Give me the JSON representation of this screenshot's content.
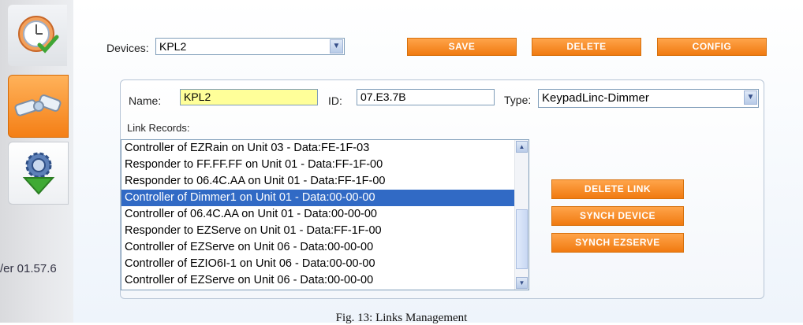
{
  "sidebar": {
    "version": "/er 01.57.6",
    "buttons": [
      {
        "icon": "clock-check-icon"
      },
      {
        "icon": "link-connector-icon"
      },
      {
        "icon": "gear-download-icon"
      }
    ]
  },
  "toolbar": {
    "devices_label": "Devices:",
    "devices_value": "KPL2",
    "save_label": "SAVE",
    "delete_label": "DELETE",
    "config_label": "CONFIG"
  },
  "device": {
    "name_label": "Name:",
    "name_value": "KPL2",
    "id_label": "ID:",
    "id_value": "07.E3.7B",
    "type_label": "Type:",
    "type_value": "KeypadLinc-Dimmer"
  },
  "links": {
    "label": "Link Records:",
    "items": [
      "Controller of EZRain on Unit 03 - Data:FE-1F-03",
      "Responder to FF.FF.FF on Unit 01 - Data:FF-1F-00",
      "Responder to 06.4C.AA on Unit 01 - Data:FF-1F-00",
      "Controller of Dimmer1 on Unit 01 - Data:00-00-00",
      "Controller of 06.4C.AA on Unit 01 - Data:00-00-00",
      "Responder to EZServe on Unit 01 - Data:FF-1F-00",
      "Controller of EZServe on Unit 06 - Data:00-00-00",
      "Controller of EZIO6I-1 on Unit 06 - Data:00-00-00",
      "Controller of EZServe on Unit 06 - Data:00-00-00"
    ],
    "selected_index": 3
  },
  "actions": {
    "delete_link": "DELETE LINK",
    "synch_device": "SYNCH DEVICE",
    "synch_ezserve": "SYNCH EZSERVE"
  },
  "caption": "Fig. 13: Links Management",
  "colors": {
    "accent_orange": "#f07a10",
    "selection_blue": "#316ac5",
    "name_field_yellow": "#ffff99"
  }
}
